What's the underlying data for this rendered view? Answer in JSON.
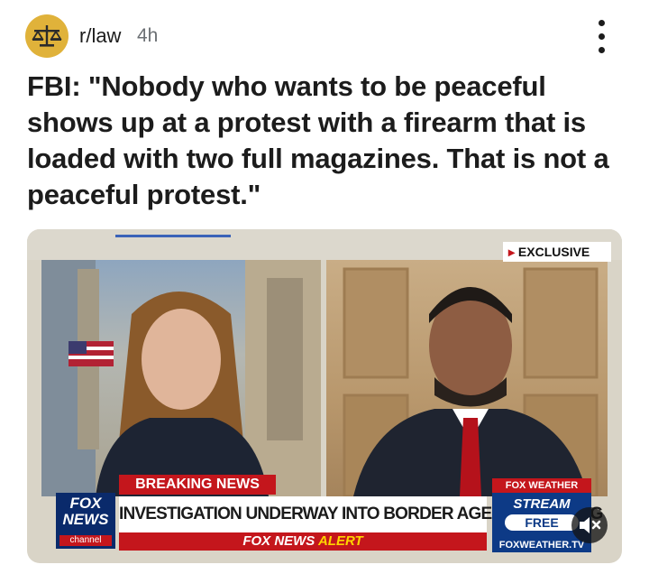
{
  "post": {
    "subreddit": "r/law",
    "age": "4h",
    "title": "FBI: \"Nobody who wants to be peaceful shows up at a protest with a firearm that is loaded with two full magazines. That is not a peaceful protest.\""
  },
  "media": {
    "exclusive_label": "EXCLUSIVE",
    "breaking_label": "BREAKING NEWS",
    "headline": "INVESTIGATION UNDERWAY INTO BORDER AGENT SHOOTING",
    "alert_prefix": "FOX NEWS",
    "alert_word": "ALERT",
    "network_logo": {
      "line1": "FOX",
      "line2": "NEWS",
      "line3": "channel"
    },
    "weather": {
      "brand": "FOX WEATHER",
      "stream": "STREAM",
      "free": "FREE",
      "url": "FOXWEATHER.TV"
    }
  },
  "icons": {
    "menu": "vertical-dots-icon",
    "mute": "speaker-muted-icon",
    "avatar": "scales-of-justice-icon"
  },
  "colors": {
    "avatar_bg": "#e0b23a",
    "fox_red": "#c4161c",
    "fox_blue": "#0a2a6b"
  }
}
